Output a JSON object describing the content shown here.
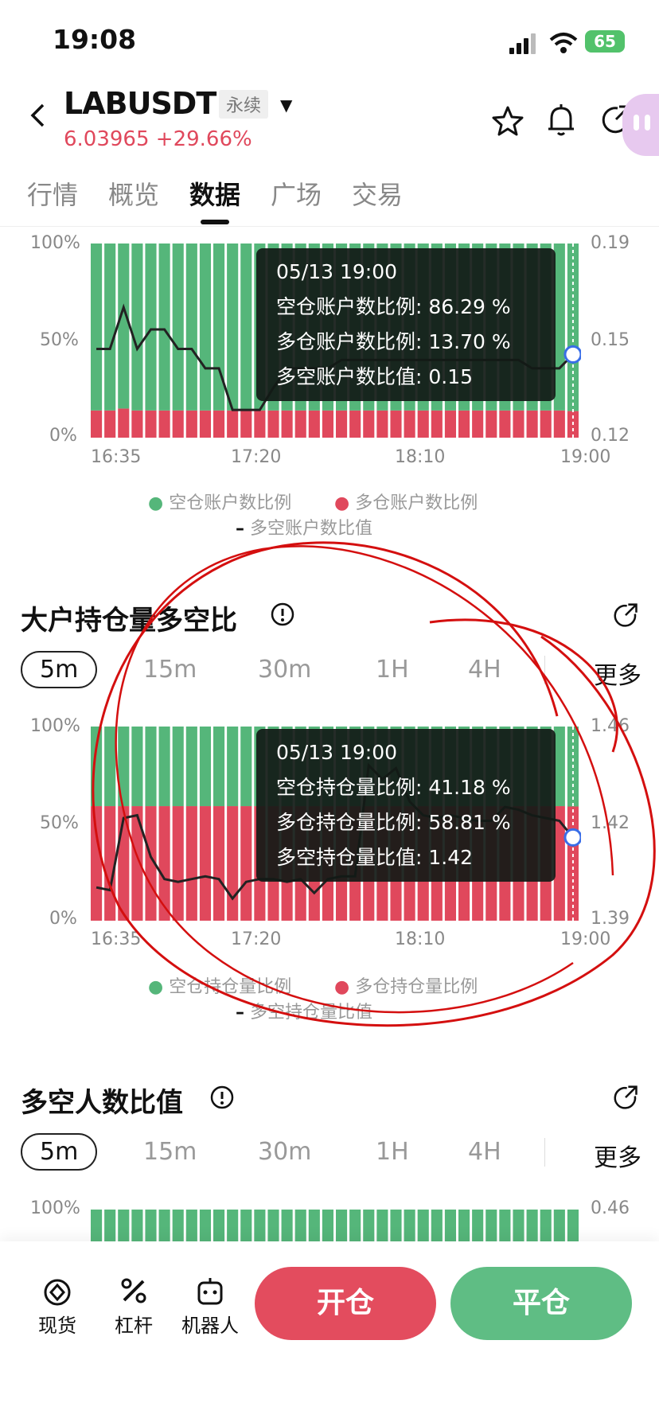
{
  "status_bar": {
    "time": "19:08",
    "battery": "65"
  },
  "header": {
    "symbol": "LABUSDT",
    "contract_type": "永续",
    "price": "6.03965",
    "change": "+29.66%"
  },
  "tabs": [
    {
      "label": "行情"
    },
    {
      "label": "概览"
    },
    {
      "label": "数据",
      "active": true
    },
    {
      "label": "广场"
    },
    {
      "label": "交易"
    }
  ],
  "chart1": {
    "y_left": [
      "100%",
      "50%",
      "0%"
    ],
    "y_right": [
      "0.19",
      "0.15",
      "0.12"
    ],
    "tooltip": {
      "time": "05/13 19:00",
      "line1": "空仓账户数比例: 86.29 %",
      "line2": "多仓账户数比例: 13.70 %",
      "line3": "多空账户数比值: 0.15"
    },
    "legend": {
      "series1": "空仓账户数比例",
      "series2": "多仓账户数比例",
      "series3": "多空账户数比值"
    }
  },
  "section2": {
    "title": "大户持仓量多空比",
    "intervals": [
      "5m",
      "15m",
      "30m",
      "1H",
      "4H"
    ],
    "more": "更多"
  },
  "chart2": {
    "y_left": [
      "100%",
      "50%",
      "0%"
    ],
    "y_right": [
      "1.46",
      "1.42",
      "1.39"
    ],
    "tooltip": {
      "time": "05/13 19:00",
      "line1": "空仓持仓量比例: 41.18 %",
      "line2": "多仓持仓量比例: 58.81 %",
      "line3": "多空持仓量比值: 1.42"
    },
    "legend": {
      "series1": "空仓持仓量比例",
      "series2": "多仓持仓量比例",
      "series3": "多空持仓量比值"
    }
  },
  "section3": {
    "title": "多空人数比值",
    "intervals": [
      "5m",
      "15m",
      "30m",
      "1H",
      "4H"
    ],
    "more": "更多"
  },
  "chart3": {
    "y_left_top": "100%",
    "y_right_top": "0.46"
  },
  "bottom_nav": {
    "spot": "现货",
    "leverage": "杠杆",
    "bot": "机器人",
    "open": "开仓",
    "close": "平仓"
  },
  "colors": {
    "green": "#55b67a",
    "red": "#e0485c",
    "annotation": "#d40f0f"
  },
  "chart_data": [
    {
      "type": "bar",
      "title": "",
      "categories_shown": [
        "16:35",
        "17:20",
        "18:10",
        "19:00"
      ],
      "series": [
        {
          "name": "空仓账户数比例",
          "values": [
            86,
            86,
            85,
            86,
            86,
            86,
            86,
            86,
            86,
            86,
            86,
            86,
            86,
            86,
            86,
            86,
            86,
            86,
            86,
            86,
            86,
            86,
            86,
            86,
            86,
            86,
            86,
            86,
            86,
            86,
            86,
            86,
            86,
            86,
            86,
            86.29
          ]
        },
        {
          "name": "多仓账户数比例",
          "values": [
            14,
            14,
            15,
            14,
            14,
            14,
            14,
            14,
            14,
            14,
            14,
            14,
            14,
            14,
            14,
            14,
            14,
            14,
            14,
            14,
            14,
            14,
            14,
            14,
            14,
            14,
            14,
            14,
            14,
            14,
            14,
            14,
            14,
            14,
            14,
            13.7
          ]
        },
        {
          "name": "多空账户数比值",
          "values": [
            0.152,
            0.152,
            0.167,
            0.152,
            0.159,
            0.159,
            0.152,
            0.152,
            0.145,
            0.145,
            0.13,
            0.13,
            0.13,
            0.138,
            0.145,
            0.145,
            0.145,
            0.145,
            0.148,
            0.148,
            0.148,
            0.148,
            0.148,
            0.148,
            0.148,
            0.148,
            0.148,
            0.148,
            0.148,
            0.148,
            0.148,
            0.148,
            0.145,
            0.145,
            0.145,
            0.15
          ]
        }
      ],
      "ylim_left": [
        0,
        100
      ],
      "ylim_right": [
        0.12,
        0.19
      ]
    },
    {
      "type": "bar",
      "title": "",
      "categories_shown": [
        "16:35",
        "17:20",
        "18:10",
        "19:00"
      ],
      "series": [
        {
          "name": "空仓持仓量比例",
          "values": [
            41,
            41,
            41,
            41,
            41,
            41,
            41,
            41,
            41,
            41,
            41,
            41,
            41,
            41,
            41,
            41,
            41,
            41,
            41,
            41,
            41,
            41,
            41,
            41,
            41,
            41,
            41,
            41,
            41,
            41,
            41,
            41,
            41,
            41,
            41,
            41.18
          ]
        },
        {
          "name": "多仓持仓量比例",
          "values": [
            59,
            59,
            59,
            59,
            59,
            59,
            59,
            59,
            59,
            59,
            59,
            59,
            59,
            59,
            59,
            59,
            59,
            59,
            59,
            59,
            59,
            59,
            59,
            59,
            59,
            59,
            59,
            59,
            59,
            59,
            59,
            59,
            59,
            59,
            59,
            58.81
          ]
        },
        {
          "name": "多空持仓量比值",
          "values": [
            1.402,
            1.401,
            1.427,
            1.428,
            1.413,
            1.405,
            1.404,
            1.405,
            1.406,
            1.405,
            1.398,
            1.404,
            1.405,
            1.405,
            1.404,
            1.405,
            1.4,
            1.405,
            1.406,
            1.406,
            1.446,
            1.441,
            1.445,
            1.433,
            1.428,
            1.427,
            1.428,
            1.427,
            1.426,
            1.426,
            1.431,
            1.43,
            1.428,
            1.427,
            1.426,
            1.42
          ]
        }
      ],
      "ylim_left": [
        0,
        100
      ],
      "ylim_right": [
        1.39,
        1.46
      ]
    }
  ]
}
